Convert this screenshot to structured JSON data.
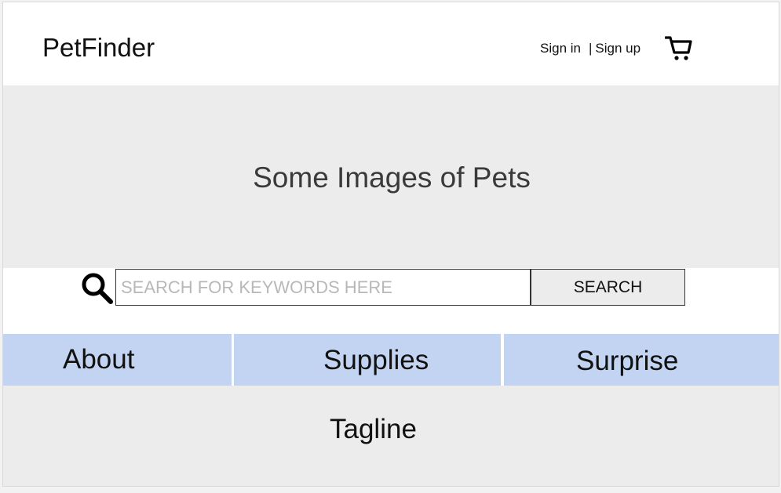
{
  "header": {
    "logo": "PetFinder",
    "sign_in": "Sign in",
    "separator": "|",
    "sign_up": "Sign up",
    "cart_icon": "shopping-cart-icon"
  },
  "hero": {
    "title": "Some Images of Pets",
    "background": "#ececec"
  },
  "search": {
    "icon": "magnifier-icon",
    "placeholder": "SEARCH FOR KEYWORDS HERE",
    "value": "",
    "button_label": "SEARCH"
  },
  "nav": {
    "color": "#c2d4f1",
    "items": [
      {
        "label": "About"
      },
      {
        "label": "Supplies"
      },
      {
        "label": "Surprise"
      }
    ]
  },
  "footer": {
    "tagline": "Tagline"
  }
}
